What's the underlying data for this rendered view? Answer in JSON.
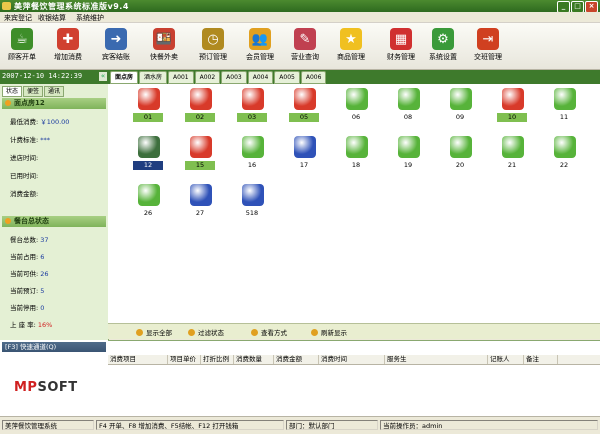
{
  "window": {
    "title": "美萍餐饮管理系统标准版v9.4"
  },
  "menu": [
    "来宾登记",
    "收银结算",
    "系统维护"
  ],
  "toolbar": [
    {
      "label": "顾客开单",
      "icon": "teacup-icon",
      "color": "#3e8e2a"
    },
    {
      "label": "增加消费",
      "icon": "add-consume-icon",
      "color": "#d04030"
    },
    {
      "label": "宾客结账",
      "icon": "checkout-icon",
      "color": "#3a6ab0"
    },
    {
      "label": "快餐外卖",
      "icon": "takeaway-icon",
      "color": "#c84030"
    },
    {
      "label": "预订管理",
      "icon": "clock-icon",
      "color": "#b08a20"
    },
    {
      "label": "会员管理",
      "icon": "members-icon",
      "color": "#e0a020"
    },
    {
      "label": "营业查询",
      "icon": "query-icon",
      "color": "#c04050"
    },
    {
      "label": "商品管理",
      "icon": "star-icon",
      "color": "#f0c020"
    },
    {
      "label": "财务管理",
      "icon": "calculator-icon",
      "color": "#d03030"
    },
    {
      "label": "系统设置",
      "icon": "gear-icon",
      "color": "#3a9a3a"
    },
    {
      "label": "交班管理",
      "icon": "exit-icon",
      "color": "#d04020"
    }
  ],
  "clock": "2007-12-10 14:22:39",
  "tabs": [
    "面点房",
    "酒水房",
    "A001",
    "A002",
    "A003",
    "A004",
    "A005",
    "A006"
  ],
  "subtabs": [
    "状态",
    "便签",
    "通讯"
  ],
  "room_panel": {
    "title": "面点房12",
    "fields": [
      {
        "label": "最低消费:",
        "value": "￥100.00"
      },
      {
        "label": "计费标准:",
        "value": "***"
      },
      {
        "label": "进店时间:",
        "value": ""
      },
      {
        "label": "已用时间:",
        "value": ""
      },
      {
        "label": "消费金额:",
        "value": ""
      }
    ]
  },
  "summary_panel": {
    "title": "餐台总状态",
    "fields": [
      {
        "label": "餐台总数:",
        "value": "37"
      },
      {
        "label": "当前占用:",
        "value": "6"
      },
      {
        "label": "当前可供:",
        "value": "26"
      },
      {
        "label": "当前预订:",
        "value": "5"
      },
      {
        "label": "当前停用:",
        "value": "0"
      },
      {
        "label": "上 座 率:",
        "value": "16%"
      }
    ]
  },
  "tables": [
    {
      "num": "01",
      "state": "occupied",
      "hl": true
    },
    {
      "num": "02",
      "state": "occupied",
      "hl": true
    },
    {
      "num": "03",
      "state": "occupied",
      "hl": true
    },
    {
      "num": "05",
      "state": "occupied",
      "hl": true
    },
    {
      "num": "06",
      "state": "free",
      "hl": false
    },
    {
      "num": "08",
      "state": "free",
      "hl": false
    },
    {
      "num": "09",
      "state": "free",
      "hl": false
    },
    {
      "num": "10",
      "state": "occupied",
      "hl": true
    },
    {
      "num": "11",
      "state": "free",
      "hl": false
    },
    {
      "num": "12",
      "state": "disabled",
      "hl": false,
      "sel": true
    },
    {
      "num": "15",
      "state": "occupied",
      "hl": true
    },
    {
      "num": "16",
      "state": "free",
      "hl": false
    },
    {
      "num": "17",
      "state": "reserved",
      "hl": false
    },
    {
      "num": "18",
      "state": "free",
      "hl": false
    },
    {
      "num": "19",
      "state": "free",
      "hl": false
    },
    {
      "num": "20",
      "state": "free",
      "hl": false
    },
    {
      "num": "21",
      "state": "free",
      "hl": false
    },
    {
      "num": "22",
      "state": "free",
      "hl": false
    },
    {
      "num": "26",
      "state": "free",
      "hl": false
    },
    {
      "num": "27",
      "state": "reserved",
      "hl": false
    },
    {
      "num": "518",
      "state": "reserved",
      "hl": false
    }
  ],
  "actions": [
    "显示全部",
    "过滤状态",
    "查看方式",
    "刷新显示"
  ],
  "quick": {
    "title": "[F3] 快速通道(Q)",
    "logo_a": "MP",
    "logo_b": "SOFT"
  },
  "columns": [
    "消费项目",
    "项目单价",
    "打折比例",
    "消费数量",
    "消费金额",
    "消费时间",
    "服务生",
    "记账人",
    "备注"
  ],
  "statusbar": [
    "美萍餐饮管理系统",
    "F4 开单、F8 增加消费、F5结帐、F12 打开钱箱",
    "部门：默认部门",
    "当前操作员：admin"
  ],
  "colors": {
    "occupied": "#d83a2a",
    "free": "#57b33a",
    "reserved": "#2f52b8",
    "disabled": "#3d6f3d"
  }
}
